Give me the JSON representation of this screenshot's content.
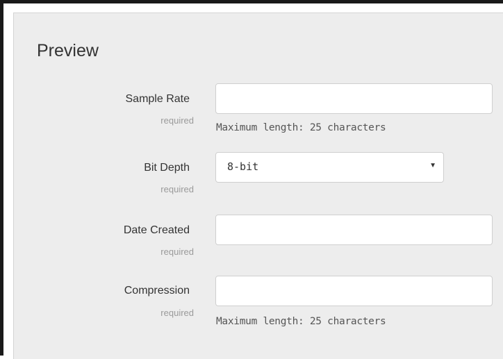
{
  "panel": {
    "title": "Preview"
  },
  "fields": {
    "sample_rate": {
      "label": "Sample Rate",
      "required": "required",
      "value": "",
      "hint": "Maximum length: 25 characters"
    },
    "bit_depth": {
      "label": "Bit Depth",
      "required": "required",
      "selected": "8-bit",
      "caret_icon": "caret-down-icon"
    },
    "date_created": {
      "label": "Date Created",
      "required": "required",
      "value": ""
    },
    "compression": {
      "label": "Compression",
      "required": "required",
      "value": "",
      "hint": "Maximum length: 25 characters"
    }
  },
  "colors": {
    "panel_background": "#ededed",
    "frame_border": "#1a1a1a",
    "input_border": "#cfcfcf",
    "text": "#333333",
    "muted_text": "#9a9a9a"
  }
}
